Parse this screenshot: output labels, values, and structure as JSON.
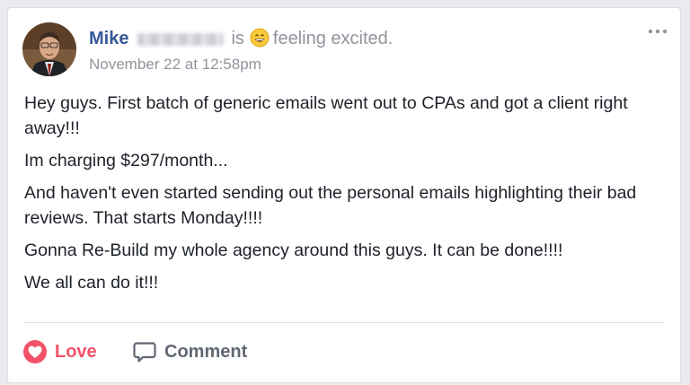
{
  "post": {
    "author": {
      "name": "Mike",
      "surname_redacted": true,
      "avatar": "avatar-photo"
    },
    "activity": {
      "verb": "is",
      "emoji": "grinning-face-icon",
      "text": "feeling excited."
    },
    "timestamp": "November 22 at 12:58pm",
    "menu_icon": "more-options-icon",
    "body": [
      "Hey guys. First batch of generic emails went out to CPAs and got a client right away!!!",
      "Im charging $297/month...",
      "And haven't even started sending out the personal emails highlighting their bad reviews. That starts Monday!!!!",
      "Gonna Re-Build my whole agency around this guys. It can be done!!!!",
      "We all can do it!!!"
    ],
    "actions": {
      "love": {
        "label": "Love",
        "icon": "love-reaction-icon",
        "color": "#f25268"
      },
      "comment": {
        "label": "Comment",
        "icon": "comment-icon",
        "color": "#606770"
      }
    }
  },
  "colors": {
    "author_link": "#365899",
    "meta_text": "#90949c",
    "body_text": "#1d2129",
    "divider": "#dddfe2"
  }
}
